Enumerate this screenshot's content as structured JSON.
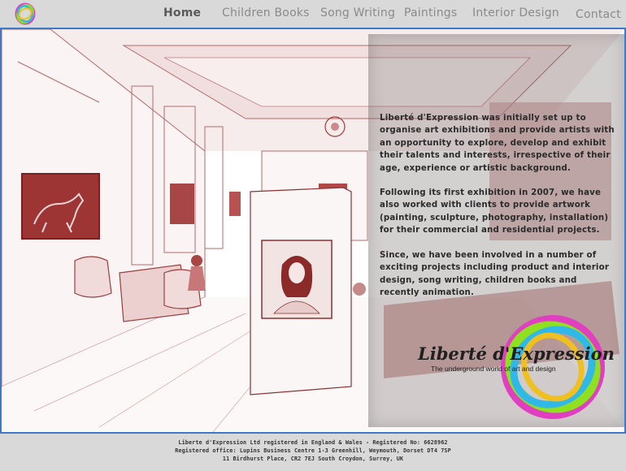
{
  "nav": {
    "items": [
      {
        "label": "Home",
        "active": true
      },
      {
        "label": "Children Books",
        "active": false
      },
      {
        "label": "Song Writing",
        "active": false
      },
      {
        "label": "Paintings",
        "active": false
      },
      {
        "label": "Interior Design",
        "active": false
      },
      {
        "label": "Contact",
        "active": false
      }
    ]
  },
  "intro": {
    "paragraph1": "Liberté d'Expression was initially set up to organise art exhibitions and provide artists with an opportunity to explore, develop and exhibit their talents and interests, irrespective of their age, experience or artistic background.",
    "paragraph2": "Following its first exhibition in 2007, we have also worked with clients to provide artwork (painting, sculpture, photography, installation) for their commercial and residential projects.",
    "paragraph3": "Since, we have been involved in a number of exciting projects including product and interior design, song writing, children books and recently animation."
  },
  "brand": {
    "name": "Liberté d'Expression",
    "tagline": "The underground world of art and design"
  },
  "footer": {
    "line1": "Liberte d'Expression Ltd registered in England & Wales - Registered No: 6628962",
    "line2": "Registered office: Lupins Business Centre 1-3 Greenhill, Weymouth, Dorset DT4 7SP",
    "line3": "11 Birdhurst Place, CR2 7EJ South Croydon, Surrey, UK"
  },
  "colors": {
    "accent_border": "#3a7ac8",
    "sketch_red": "#a33a3a",
    "background_grey": "#d9d9d9"
  }
}
